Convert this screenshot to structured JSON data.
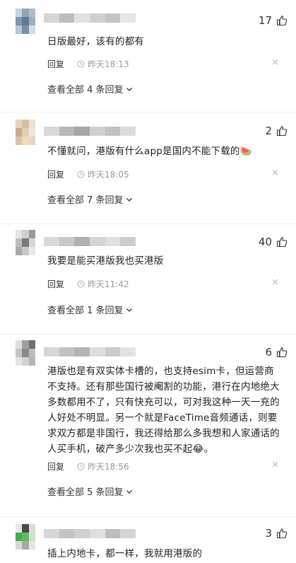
{
  "comments": [
    {
      "likes": "17",
      "text": "日版最好，该有的都有",
      "reply_label": "回复",
      "time": "昨天18:13",
      "close": "×",
      "view_more": "查看全部 4 条回复",
      "avatar_colors": [
        "#c9d3dd",
        "#8fa4b8",
        "#aebccb",
        "#7f96ad",
        "#5e7c99",
        "#9fb0c2",
        "#b8c5d2",
        "#7590aa",
        "#d2dbe4"
      ],
      "name_colors": [
        "#d6d6d6",
        "#bdbdbd",
        "#e2e2e2",
        "#cfcfcf",
        "#c4c4c4",
        "#e6e6e6"
      ]
    },
    {
      "likes": "2",
      "text": "不懂就问，港版有什么app是国内不能下载的🍉",
      "reply_label": "回复",
      "time": "昨天18:05",
      "close": "×",
      "view_more": "查看全部 7 条回复",
      "avatar_colors": [
        "#e5d3c1",
        "#d8bea3",
        "#efe2d4",
        "#c9ab8c",
        "#e6cdb2",
        "#f2e6d8",
        "#d9c3ad",
        "#f0d9b9",
        "#e8d6c4"
      ],
      "name_colors": [
        "#d9d9d9",
        "#b8b8b8",
        "#a6a6a6",
        "#d0d0d0",
        "#c2c2c2",
        "#dcdcdc"
      ]
    },
    {
      "likes": "40",
      "text": "我要是能买港版我也买港版",
      "reply_label": "回复",
      "time": "昨天11:42",
      "close": "×",
      "view_more": "查看全部 1 条回复",
      "avatar_colors": [
        "#e3e3e3",
        "#cfcfcf",
        "#9a9a9a",
        "#bdbdbd",
        "#7a7a7a",
        "#d7d7d7",
        "#a8a8a8",
        "#c6c6c6",
        "#e9e9e9"
      ],
      "name_colors": [
        "#dadada",
        "#c8c8c8",
        "#b0b0b0",
        "#d4d4d4",
        "#e0e0e0",
        "#cccccc"
      ]
    },
    {
      "likes": "6",
      "text": "港版也是有双实体卡槽的，也支持esim卡，但运营商不支持。还有那些国行被阉割的功能，港行在内地绝大多数都用不了，只有快充可以，可对我这种一天一充的人好处不明显。另一个就是FaceTime音频通话，则要求双方都是非国行，我还得给那么多我想和人家通话的人买手机，破产多少次我也买不起😂。",
      "reply_label": "回复",
      "time": "昨天18:56",
      "close": "×",
      "view_more": "查看全部 5 条回复",
      "avatar_colors": [
        "#dedede",
        "#a0a0a0",
        "#6e6e6e",
        "#c5c5c5",
        "#8b8b8b",
        "#bcbcbc",
        "#e4e4e4",
        "#d2d2d2",
        "#b5b5b5"
      ],
      "name_colors": [
        "#d7d7d7",
        "#c3c3c3",
        "#b4b4b4",
        "#dcdcdc",
        "#cbcbcb",
        "#e3e3e3"
      ]
    },
    {
      "likes": "3",
      "text": "插上内地卡，都一样，我就用港版的",
      "avatar_colors": [
        "#e7e7e7",
        "#4a4a4a",
        "#dcdcdc",
        "#4ca84c",
        "#58c05a",
        "#c7e6c7",
        "#d8d8d8",
        "#a9a9a9",
        "#e5e5e5"
      ],
      "name_colors": [
        "#d8d8d8",
        "#c4c4c4",
        "#cfcfcf",
        "#e0e0e0",
        "#bdbdbd",
        "#d6d6d6"
      ]
    }
  ]
}
